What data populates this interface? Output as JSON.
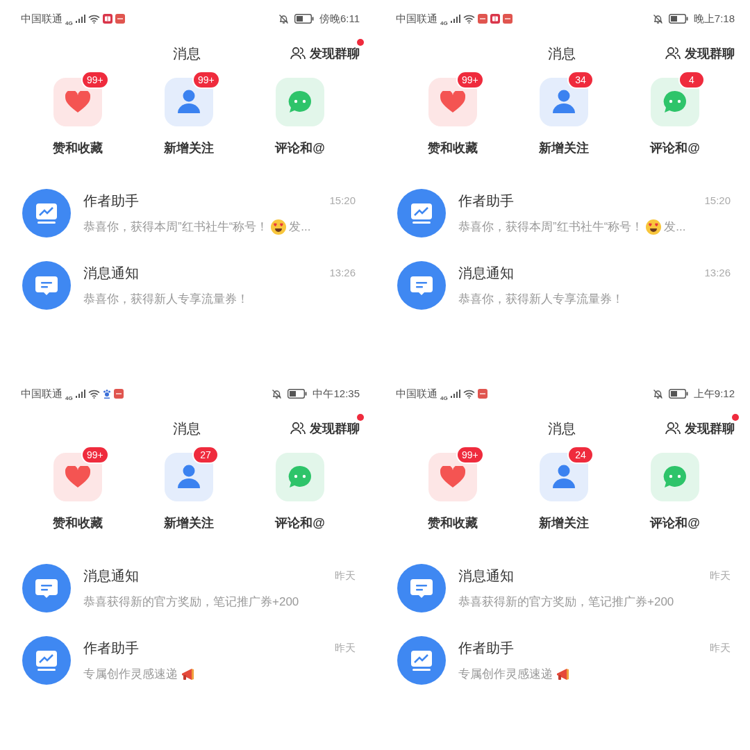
{
  "screens": [
    {
      "status_bar": {
        "carrier": "中国联通",
        "network": "4G",
        "notification_icons": [
          {
            "kind": "book"
          },
          {
            "kind": "app"
          }
        ],
        "time": "傍晚6:11"
      },
      "header": {
        "title": "消息",
        "group_chat": {
          "label": "发现群聊",
          "dot": true
        }
      },
      "categories": [
        {
          "kind": "likes",
          "label": "赞和收藏",
          "badge": "99+"
        },
        {
          "kind": "follows",
          "label": "新增关注",
          "badge": "99+"
        },
        {
          "kind": "comments",
          "label": "评论和@"
        }
      ],
      "messages": [
        {
          "kind": "assistant",
          "title": "作者助手",
          "time": "15:20",
          "preview": "恭喜你，获得本周”红书社牛“称号！",
          "trailing_icon": {
            "kind": "heart-eyes"
          },
          "preview_end": "发..."
        },
        {
          "kind": "notice",
          "title": "消息通知",
          "time": "13:26",
          "preview": "恭喜你，获得新人专享流量券！"
        }
      ]
    },
    {
      "status_bar": {
        "carrier": "中国联通",
        "network": "4G",
        "notification_icons": [
          {
            "kind": "app"
          },
          {
            "kind": "book"
          },
          {
            "kind": "app"
          }
        ],
        "time": "晚上7:18"
      },
      "header": {
        "title": "消息",
        "group_chat": {
          "label": "发现群聊",
          "dot": false
        }
      },
      "categories": [
        {
          "kind": "likes",
          "label": "赞和收藏",
          "badge": "99+"
        },
        {
          "kind": "follows",
          "label": "新增关注",
          "badge": "34"
        },
        {
          "kind": "comments",
          "label": "评论和@",
          "badge": "4"
        }
      ],
      "messages": [
        {
          "kind": "assistant",
          "title": "作者助手",
          "time": "15:20",
          "preview": "恭喜你，获得本周”红书社牛“称号！",
          "trailing_icon": {
            "kind": "heart-eyes"
          },
          "preview_end": "发..."
        },
        {
          "kind": "notice",
          "title": "消息通知",
          "time": "13:26",
          "preview": "恭喜你，获得新人专享流量券！"
        }
      ]
    },
    {
      "status_bar": {
        "carrier": "中国联通",
        "network": "4G",
        "notification_icons": [
          {
            "kind": "paw"
          },
          {
            "kind": "app"
          }
        ],
        "time": "中午12:35"
      },
      "header": {
        "title": "消息",
        "group_chat": {
          "label": "发现群聊",
          "dot": true
        }
      },
      "categories": [
        {
          "kind": "likes",
          "label": "赞和收藏",
          "badge": "99+"
        },
        {
          "kind": "follows",
          "label": "新增关注",
          "badge": "27"
        },
        {
          "kind": "comments",
          "label": "评论和@"
        }
      ],
      "messages": [
        {
          "kind": "notice",
          "title": "消息通知",
          "time": "昨天",
          "preview": "恭喜获得新的官方奖励，笔记推广券+200"
        },
        {
          "kind": "assistant",
          "title": "作者助手",
          "time": "昨天",
          "preview": "专属创作灵感速递",
          "trailing_icon": {
            "kind": "megaphone"
          }
        }
      ]
    },
    {
      "status_bar": {
        "carrier": "中国联通",
        "network": "4G",
        "notification_icons": [
          {
            "kind": "app"
          }
        ],
        "time": "上午9:12"
      },
      "header": {
        "title": "消息",
        "group_chat": {
          "label": "发现群聊",
          "dot": true
        }
      },
      "categories": [
        {
          "kind": "likes",
          "label": "赞和收藏",
          "badge": "99+"
        },
        {
          "kind": "follows",
          "label": "新增关注",
          "badge": "24"
        },
        {
          "kind": "comments",
          "label": "评论和@"
        }
      ],
      "messages": [
        {
          "kind": "notice",
          "title": "消息通知",
          "time": "昨天",
          "preview": "恭喜获得新的官方奖励，笔记推广券+200"
        },
        {
          "kind": "assistant",
          "title": "作者助手",
          "time": "昨天",
          "preview": "专属创作灵感速递",
          "trailing_icon": {
            "kind": "megaphone"
          }
        }
      ]
    }
  ]
}
